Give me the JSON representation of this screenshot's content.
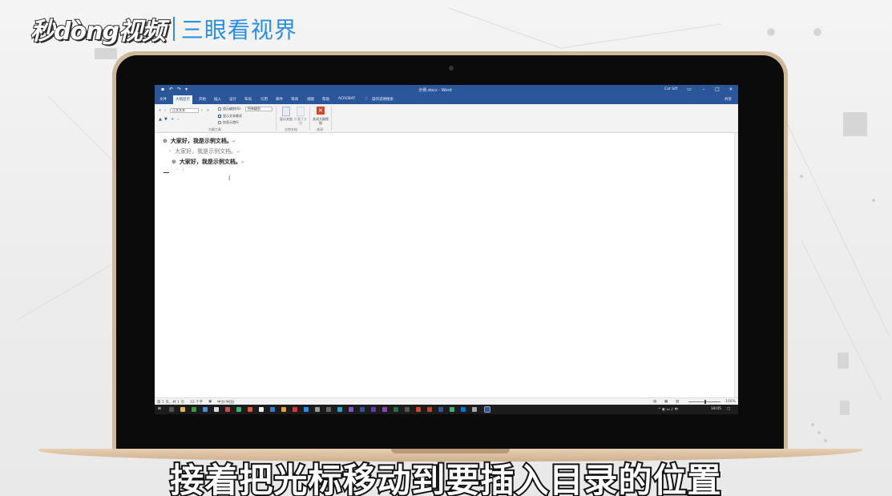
{
  "brand": {
    "name": "秒dòng视频",
    "channel": "三眼看视界"
  },
  "window": {
    "title": "示例.docx - Word",
    "user": "Cat Sift"
  },
  "ribbon": {
    "tabs": [
      "文件",
      "大纲显示",
      "开始",
      "插入",
      "设计",
      "布局",
      "引用",
      "邮件",
      "审阅",
      "视图",
      "帮助",
      "ACROBAT"
    ],
    "tell_me": "操作说明搜索",
    "share": "共享",
    "outline_level": "正文文本",
    "show_level": "所有级别",
    "checkboxes": [
      {
        "label": "显示级别(S):",
        "checked": false
      },
      {
        "label": "显示文本格式",
        "checked": true
      },
      {
        "label": "仅显示首行",
        "checked": false
      }
    ],
    "group_outline_tools": "大纲工具",
    "btn_show_document": "显示文档",
    "btn_collapse_subdocs": "折叠子文档",
    "group_master_document": "主控文档",
    "btn_close_outline": "关闭大纲视图",
    "group_close": "关闭"
  },
  "document": {
    "lines": [
      {
        "text": "大家好，我是示例文档。",
        "level": 1
      },
      {
        "text": "大家好，我是示例文档。",
        "level": 2
      },
      {
        "text": "大家好，我是示例文档。",
        "level": 3
      }
    ],
    "pilcrow": "↵"
  },
  "status": {
    "page": "第 1 页，共 1 页",
    "words": "33 个字",
    "language": "中文(中国)",
    "zoom": "100%"
  },
  "taskbar": {
    "time": "18:05"
  },
  "subtitle": "接着把光标移动到要插入目录的位置"
}
